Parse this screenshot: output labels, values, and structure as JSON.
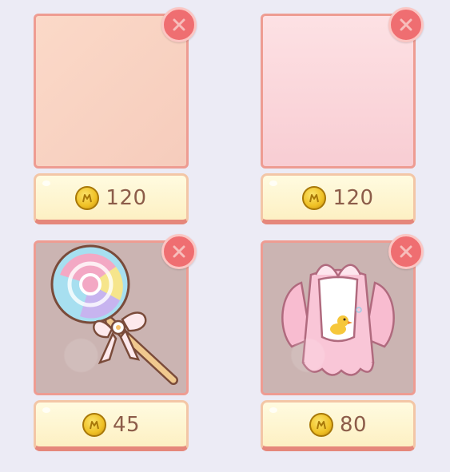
{
  "shop": {
    "items": [
      {
        "price": "120",
        "image": "blank-peach",
        "remove_icon": "close-icon",
        "currency_icon": "gold-coin-icon"
      },
      {
        "price": "120",
        "image": "blank-pink",
        "remove_icon": "close-icon",
        "currency_icon": "gold-coin-icon"
      },
      {
        "price": "45",
        "image": "lollipop-icon",
        "remove_icon": "close-icon",
        "currency_icon": "gold-coin-icon"
      },
      {
        "price": "80",
        "image": "duck-bib-outfit-icon",
        "remove_icon": "close-icon",
        "currency_icon": "gold-coin-icon"
      }
    ]
  },
  "colors": {
    "background": "#ecebf5",
    "frame_border": "#ee9c92",
    "remove_button": "#ef6e71",
    "price_text": "#8c5c49",
    "coin": "#efc024"
  }
}
